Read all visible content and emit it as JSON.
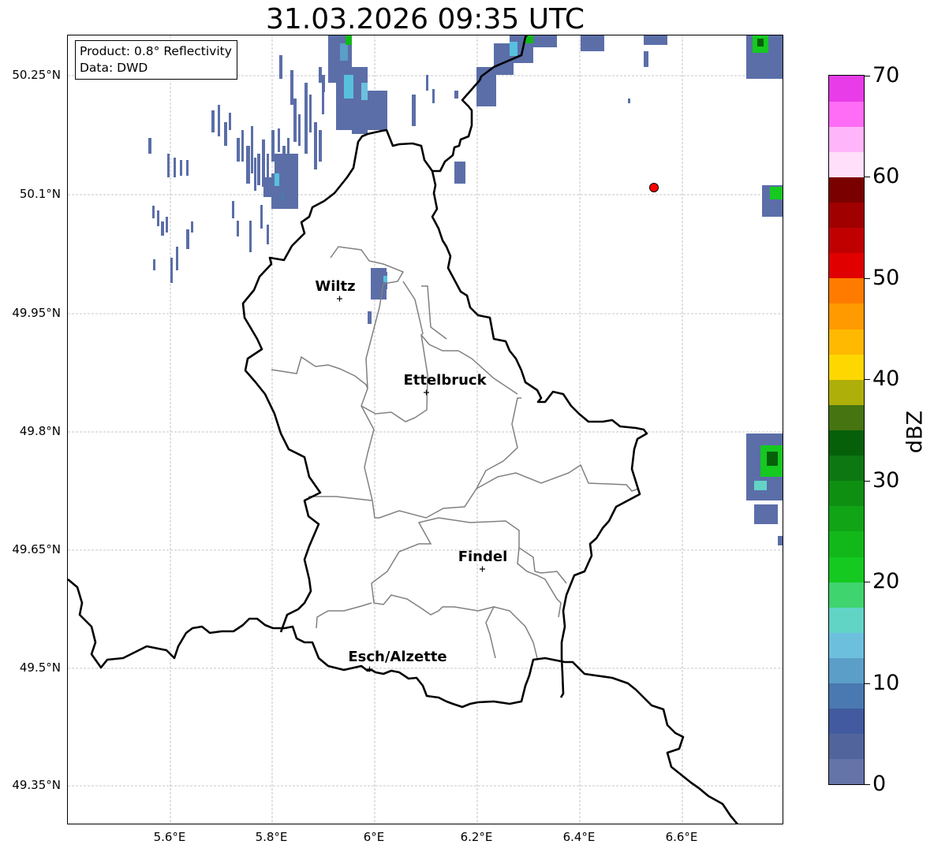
{
  "title": "31.03.2026 09:35 UTC",
  "info_box": {
    "product": "Product: 0.8° Reflectivity",
    "data": "Data: DWD"
  },
  "lat_labels": [
    "50.25°N",
    "50.1°N",
    "49.95°N",
    "49.8°N",
    "49.65°N",
    "49.5°N",
    "49.35°N"
  ],
  "lon_labels": [
    "5.6°E",
    "5.8°E",
    "6°E",
    "6.2°E",
    "6.4°E",
    "6.6°E"
  ],
  "cities": [
    {
      "name": "Wiltz"
    },
    {
      "name": "Ettelbruck"
    },
    {
      "name": "Findel"
    },
    {
      "name": "Esch/Alzette"
    }
  ],
  "radar_site": {
    "marker_color": "#ff0000"
  },
  "colorbar": {
    "label": "dBZ",
    "ticks": [
      "0",
      "10",
      "20",
      "30",
      "40",
      "50",
      "60",
      "70"
    ],
    "colors": [
      "#6473a8",
      "#51659c",
      "#425aa0",
      "#4a78b0",
      "#5b9ec8",
      "#6cc0de",
      "#62d4c6",
      "#3fd46e",
      "#15c920",
      "#12b81a",
      "#10a416",
      "#0f8f12",
      "#0d7811",
      "#06600a",
      "#467410",
      "#afaf0a",
      "#ffd700",
      "#ffb900",
      "#ff9a00",
      "#ff7b00",
      "#e00000",
      "#c00000",
      "#a00000",
      "#7a0000",
      "#ffdff9",
      "#ffb5fa",
      "#ff6cf5",
      "#e83ce8"
    ]
  }
}
